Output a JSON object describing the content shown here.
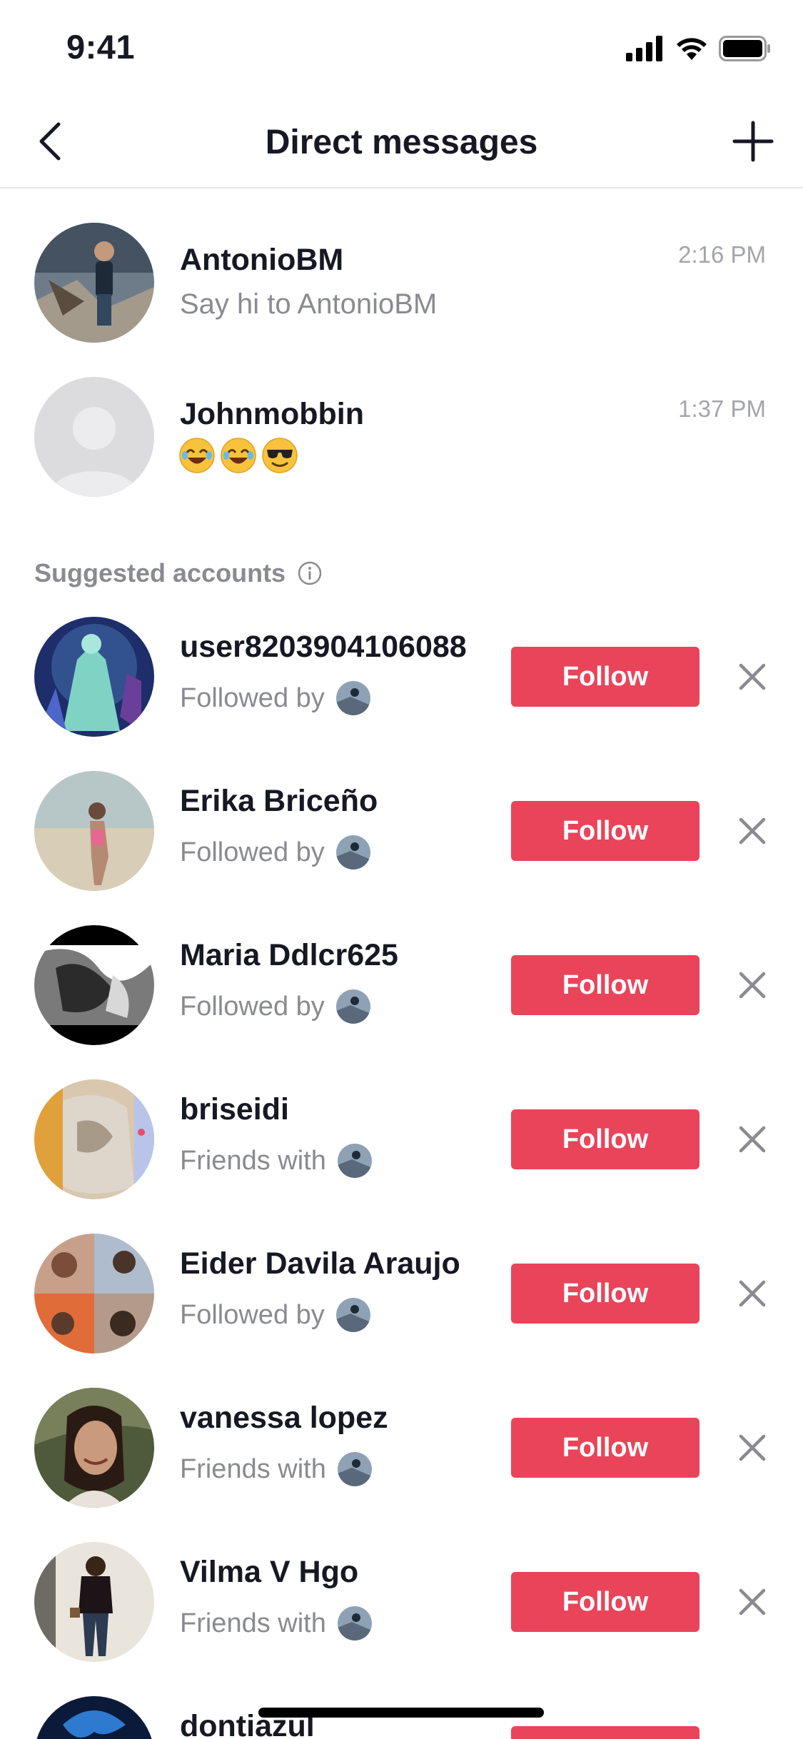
{
  "status_bar": {
    "time": "9:41"
  },
  "nav": {
    "title": "Direct messages"
  },
  "conversations": [
    {
      "name": "AntonioBM",
      "preview": "Say hi to AntonioBM",
      "time": "2:16 PM"
    },
    {
      "name": "Johnmobbin",
      "preview_emojis": [
        "😂",
        "😂",
        "😎"
      ],
      "time": "1:37 PM"
    }
  ],
  "suggested": {
    "header": "Suggested accounts",
    "follow_label": "Follow",
    "accounts": [
      {
        "name": "user8203904106088",
        "relation": "Followed by"
      },
      {
        "name": "Erika Briceño",
        "relation": "Followed by"
      },
      {
        "name": "Maria Ddlcr625",
        "relation": "Followed by"
      },
      {
        "name": "briseidi",
        "relation": "Friends with"
      },
      {
        "name": "Eider Davila Araujo",
        "relation": "Followed by"
      },
      {
        "name": "vanessa lopez",
        "relation": "Friends with"
      },
      {
        "name": "Vilma V Hgo",
        "relation": "Friends with"
      },
      {
        "name": "dontiazul",
        "relation": ""
      }
    ]
  },
  "colors": {
    "accent": "#ea445a",
    "secondary_text": "#8a8b91",
    "divider": "#e5e5e5"
  }
}
